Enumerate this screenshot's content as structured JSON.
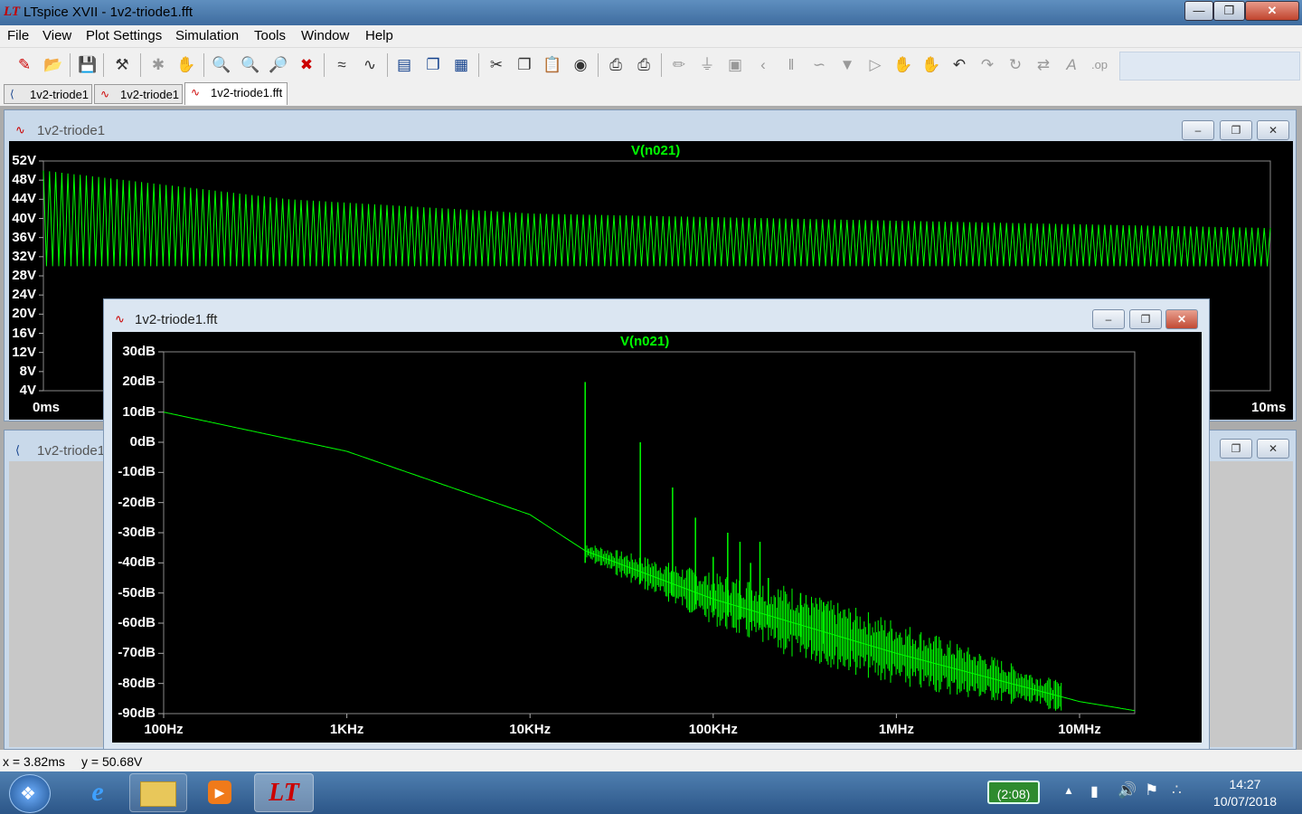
{
  "window": {
    "title": "LTspice XVII - 1v2-triode1.fft",
    "logo": "LT"
  },
  "menu": {
    "items": [
      "File",
      "View",
      "Plot Settings",
      "Simulation",
      "Tools",
      "Window",
      "Help"
    ]
  },
  "toolbar": {
    "icons": [
      "new-schematic-icon",
      "open-icon",
      "save-icon",
      "control-panel-icon",
      "run-icon",
      "halt-icon",
      "pan-icon",
      "zoom-in-icon",
      "zoom-area-icon",
      "zoom-out-icon",
      "zoom-fit-icon",
      "autoscale-icon",
      "waveform-icon",
      "tile-horizontal-icon",
      "cascade-icon",
      "tile-vertical-icon",
      "cut-icon",
      "copy-icon",
      "paste-icon",
      "find-icon",
      "print-icon",
      "print-setup-icon",
      "wire-icon",
      "ground-icon",
      "label-icon",
      "resistor-icon",
      "capacitor-icon",
      "inductor-icon",
      "diode-icon",
      "component-icon",
      "move-icon",
      "drag-icon",
      "undo-icon",
      "redo-icon",
      "rotate-icon",
      "mirror-icon",
      "text-icon",
      "spice-directive-icon"
    ]
  },
  "tabs": [
    {
      "label": "1v2-triode1",
      "icon": "schematic-icon",
      "active": false
    },
    {
      "label": "1v2-triode1",
      "icon": "waveform-icon",
      "active": false
    },
    {
      "label": "1v2-triode1.fft",
      "icon": "waveform-icon",
      "active": true
    }
  ],
  "windows": {
    "transient": {
      "title": "1v2-triode1",
      "trace": "V(n021)",
      "y_ticks": [
        "52V",
        "48V",
        "44V",
        "40V",
        "36V",
        "32V",
        "28V",
        "24V",
        "20V",
        "16V",
        "12V",
        "8V",
        "4V"
      ],
      "x_ticks": [
        "0ms",
        "10ms"
      ]
    },
    "schematic": {
      "title": "1v2-triode1"
    },
    "fft": {
      "title": "1v2-triode1.fft",
      "trace": "V(n021)",
      "y_ticks": [
        "30dB",
        "20dB",
        "10dB",
        "0dB",
        "-10dB",
        "-20dB",
        "-30dB",
        "-40dB",
        "-50dB",
        "-60dB",
        "-70dB",
        "-80dB",
        "-90dB"
      ],
      "x_ticks": [
        "100Hz",
        "1KHz",
        "10KHz",
        "100KHz",
        "1MHz",
        "10MHz"
      ]
    }
  },
  "colors": {
    "trace": "#00ff00",
    "plot_background": "#000000",
    "axis_text": "#ffffff"
  },
  "status": {
    "x": "x = 3.82ms",
    "y": "y = 50.68V"
  },
  "taskbar": {
    "battery": "(2:08)",
    "time": "14:27",
    "date": "10/07/2018"
  },
  "chart_data": [
    {
      "type": "line",
      "title": "V(n021)",
      "xlabel": "",
      "ylabel": "",
      "x_range_ms": [
        0,
        10
      ],
      "ylim": [
        4,
        52
      ],
      "envelope": {
        "x_ms": [
          0,
          2,
          4,
          6,
          8,
          10
        ],
        "upper_V": [
          50,
          44,
          41,
          40,
          39,
          38
        ],
        "lower_V": [
          30,
          30,
          30,
          30,
          30,
          30
        ]
      },
      "cycles": 200
    },
    {
      "type": "line",
      "title": "V(n021)",
      "xscale": "log",
      "xlim": [
        100,
        20000000
      ],
      "ylim": [
        -90,
        30
      ],
      "baseline": {
        "x": [
          100,
          1000,
          10000,
          20000,
          100000,
          1000000,
          10000000,
          20000000
        ],
        "y": [
          10,
          -3,
          -24,
          -36,
          -52,
          -70,
          -86,
          -89
        ]
      },
      "peaks": [
        {
          "x": 20000,
          "y": 20
        },
        {
          "x": 40000,
          "y": 0
        },
        {
          "x": 60000,
          "y": -15
        },
        {
          "x": 80000,
          "y": -25
        },
        {
          "x": 100000,
          "y": -38
        },
        {
          "x": 120000,
          "y": -30
        },
        {
          "x": 140000,
          "y": -33
        },
        {
          "x": 160000,
          "y": -40
        },
        {
          "x": 180000,
          "y": -33
        },
        {
          "x": 200000,
          "y": -45
        },
        {
          "x": 300000,
          "y": -50
        },
        {
          "x": 400000,
          "y": -53
        }
      ]
    }
  ]
}
